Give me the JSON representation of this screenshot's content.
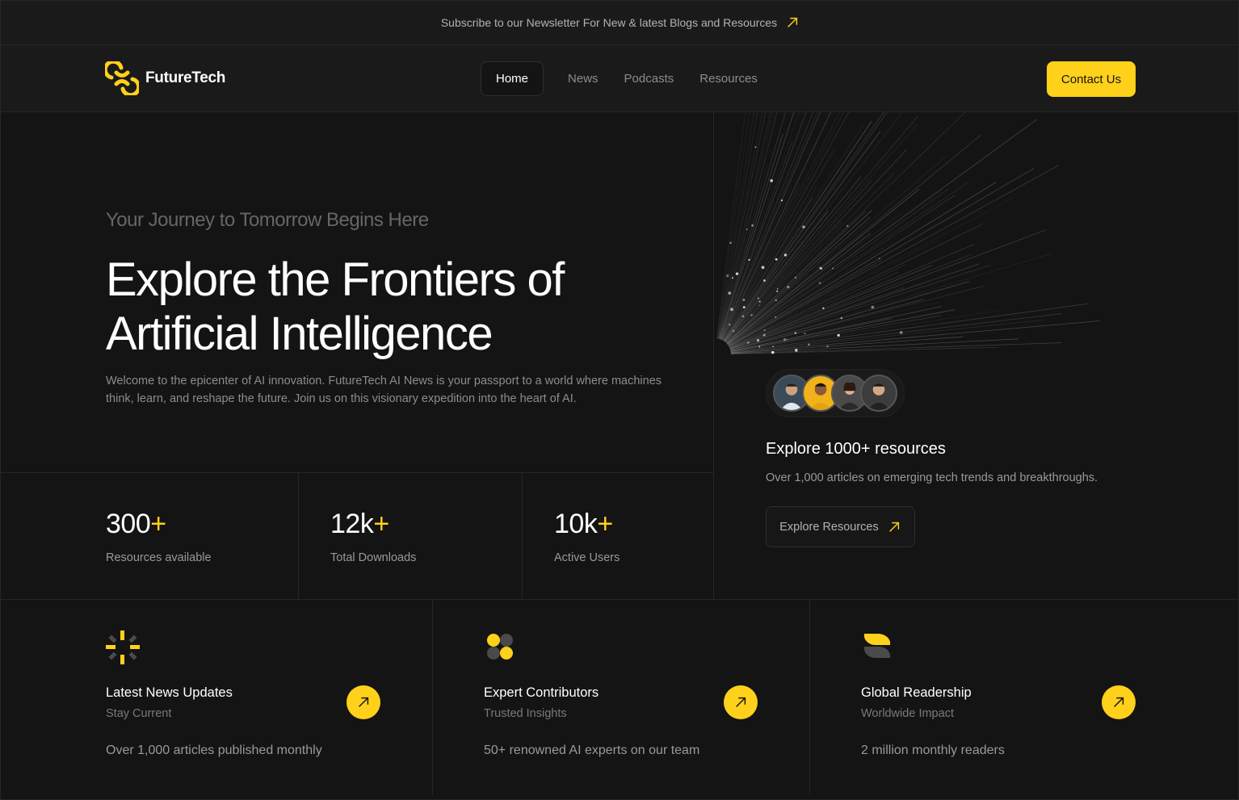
{
  "topbar": {
    "text": "Subscribe to our Newsletter For New & latest Blogs and Resources",
    "icon": "arrow-up-right-icon"
  },
  "brand": {
    "name": "FutureTech",
    "accent": "#ffd11a"
  },
  "nav": {
    "items": [
      "Home",
      "News",
      "Podcasts",
      "Resources"
    ],
    "active": "Home",
    "contact_label": "Contact Us"
  },
  "hero": {
    "tagline": "Your Journey to Tomorrow Begins Here",
    "headline": "Explore the Frontiers of Artificial Intelligence",
    "intro": "Welcome to the epicenter of AI innovation. FutureTech AI News is your passport to a world where machines think, learn, and reshape the future. Join us on this visionary expedition into the heart of AI."
  },
  "stats": [
    {
      "value": "300",
      "suffix": "+",
      "label": "Resources available"
    },
    {
      "value": "12k",
      "suffix": "+",
      "label": "Total Downloads"
    },
    {
      "value": "10k",
      "suffix": "+",
      "label": "Active Users"
    }
  ],
  "resources": {
    "title": "Explore 1000+ resources",
    "description": "Over 1,000 articles on emerging tech trends and breakthroughs.",
    "button_label": "Explore Resources"
  },
  "features": [
    {
      "icon": "sparkle-burst-icon",
      "title": "Latest News Updates",
      "subtitle": "Stay Current",
      "description": "Over 1,000 articles published monthly"
    },
    {
      "icon": "clover-icon",
      "title": "Expert Contributors",
      "subtitle": "Trusted Insights",
      "description": "50+ renowned AI experts on our team"
    },
    {
      "icon": "leaf-icon",
      "title": "Global Readership",
      "subtitle": "Worldwide Impact",
      "description": "2 million monthly readers"
    }
  ]
}
